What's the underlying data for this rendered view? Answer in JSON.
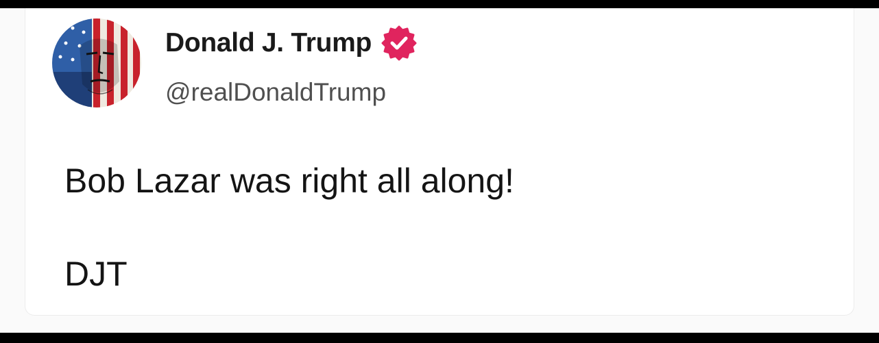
{
  "post": {
    "author": {
      "display_name": "Donald J. Trump",
      "handle": "@realDonaldTrump",
      "verified": true,
      "verified_icon": "verified-badge-icon",
      "avatar_icon": "profile-avatar"
    },
    "body": "Bob Lazar was right all along!",
    "signature": "DJT"
  },
  "colors": {
    "verified_badge": "#e0245e",
    "text_primary": "#141414",
    "text_secondary": "#4f4f4f",
    "card_background": "#ffffff",
    "frame": "#000000"
  }
}
